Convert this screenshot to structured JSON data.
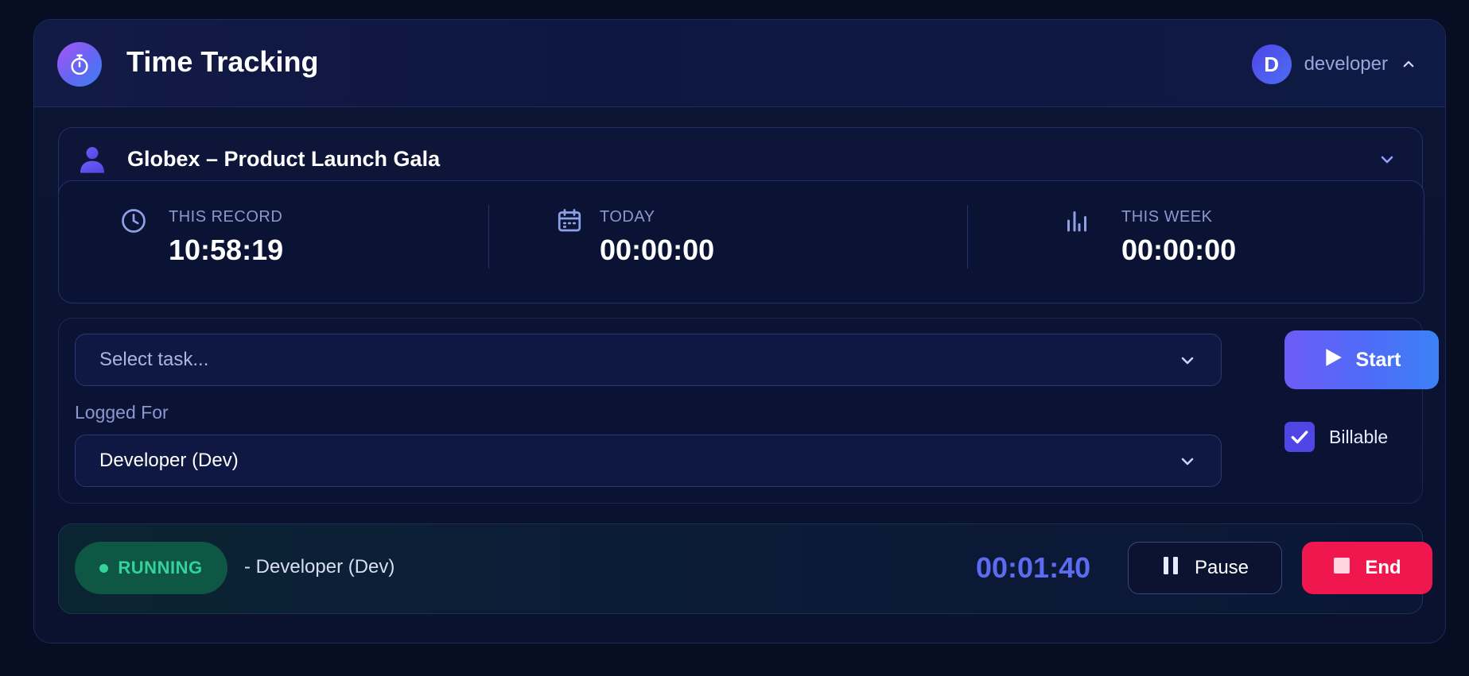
{
  "header": {
    "title": "Time Tracking",
    "logo_icon": "stopwatch-icon",
    "user": {
      "initial": "D",
      "name": "developer",
      "menu_icon": "chevron-up-icon"
    }
  },
  "project": {
    "icon": "person-icon",
    "title": "Globex – Product Launch Gala",
    "expand_icon": "chevron-down-icon"
  },
  "stats": [
    {
      "icon": "clock-icon",
      "label": "THIS RECORD",
      "value": "10:58:19"
    },
    {
      "icon": "calendar-icon",
      "label": "TODAY",
      "value": "00:00:00"
    },
    {
      "icon": "bar-chart-icon",
      "label": "THIS WEEK",
      "value": "00:00:00"
    }
  ],
  "controls": {
    "task_select": {
      "placeholder": "Select task..."
    },
    "logged_for": {
      "label": "Logged For",
      "value": "Developer (Dev)"
    },
    "start_label": "Start",
    "billable": {
      "label": "Billable",
      "checked": true
    }
  },
  "running": {
    "status": "RUNNING",
    "description": "- Developer (Dev)",
    "elapsed": "00:01:40",
    "pause_label": "Pause",
    "end_label": "End"
  },
  "colors": {
    "accent": "#4f46e5",
    "running_green": "#34d399",
    "end_red": "#f0174f",
    "timer_blue": "#5b6cf0"
  }
}
